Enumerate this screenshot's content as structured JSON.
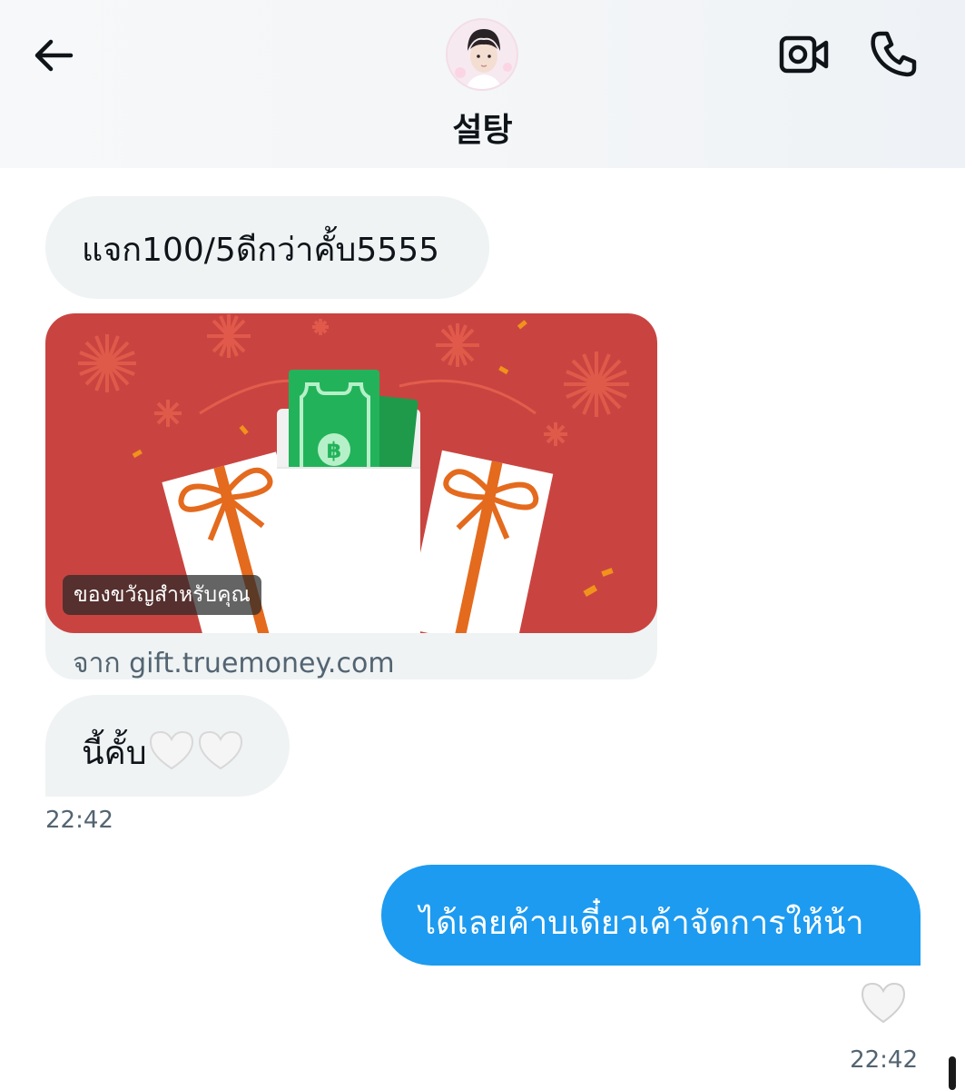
{
  "header": {
    "contact_name": "설탕",
    "back_icon": "arrow-left-icon",
    "video_icon": "video-call-icon",
    "call_icon": "phone-icon"
  },
  "messages": [
    {
      "type": "received",
      "text": "แจก100/5ดีกว่าคั้บ5555"
    },
    {
      "type": "received-card",
      "card_badge": "ของขวัญสำหรับคุณ",
      "card_domain": "จาก gift.truemoney.com"
    },
    {
      "type": "received",
      "text": "นี้คั้บ",
      "emoji": "white-heart-icon white-heart-icon",
      "time": "22:42"
    },
    {
      "type": "sent",
      "text": "ได้เลยค้าบเดี๋ยวเค้าจัดการให้น้า",
      "reaction": "white-heart-icon",
      "time": "22:42"
    }
  ],
  "colors": {
    "sent_bubble": "#1d9bf0",
    "received_bubble": "#eff3f4",
    "card_red": "#c94440",
    "timestamp": "#536471"
  }
}
